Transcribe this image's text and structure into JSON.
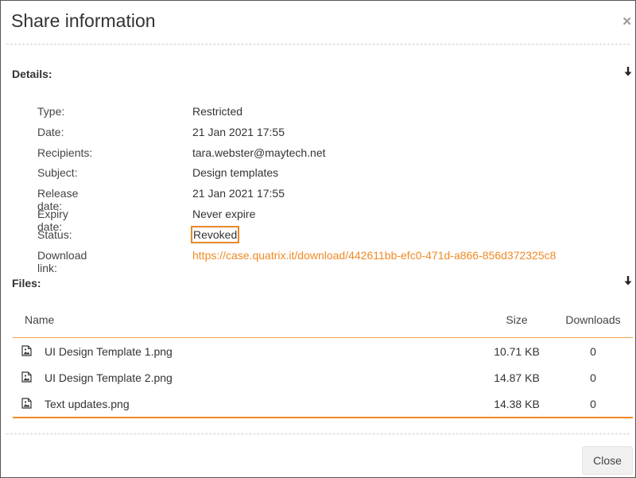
{
  "dialog": {
    "title": "Share information",
    "close_icon": "close-icon",
    "close_button_label": "Close"
  },
  "details": {
    "heading": "Details:",
    "toggle_icon": "arrow-down-icon",
    "rows": [
      {
        "label": "Type:",
        "value": "Restricted"
      },
      {
        "label": "Date:",
        "value": "21 Jan 2021 17:55"
      },
      {
        "label": "Recipients:",
        "value": "tara.webster@maytech.net"
      },
      {
        "label": "Subject:",
        "value": "Design templates"
      },
      {
        "label": "Release date:",
        "value": "21 Jan 2021 17:55"
      },
      {
        "label": "Expiry date:",
        "value": "Never expire"
      },
      {
        "label": "Status:",
        "value": "Revoked"
      },
      {
        "label": "Download link:",
        "value": "https://case.quatrix.it/download/442611bb-efc0-471d-a866-856d372325c8"
      }
    ]
  },
  "files": {
    "heading": "Files:",
    "toggle_icon": "arrow-down-icon",
    "columns": [
      "Name",
      "Size",
      "Downloads"
    ],
    "rows": [
      {
        "name": "UI Design Template 1.png",
        "size": "10.71 KB",
        "downloads": "0",
        "icon": "image-file-icon"
      },
      {
        "name": "UI Design Template 2.png",
        "size": "14.87 KB",
        "downloads": "0",
        "icon": "image-file-icon"
      },
      {
        "name": "Text updates.png",
        "size": "14.38 KB",
        "downloads": "0",
        "icon": "image-file-icon"
      }
    ]
  },
  "colors": {
    "accent": "#f08a24",
    "status_highlight": "#e8892b"
  }
}
